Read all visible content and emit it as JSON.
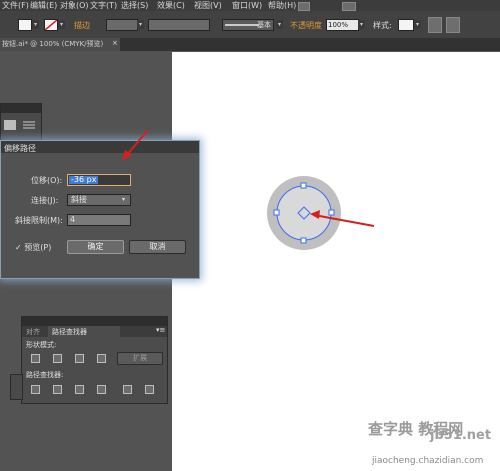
{
  "menu": {
    "file": "文件(F)",
    "edit": "编辑(E)",
    "object": "对象(O)",
    "type": "文字(T)",
    "select": "选择(S)",
    "effect": "效果(C)",
    "view": "视图(V)",
    "window": "窗口(W)",
    "help": "帮助(H)"
  },
  "control": {
    "stroke_label": "描边",
    "brush_label": "基本",
    "opacity_label": "不透明度",
    "opacity_value": "100%",
    "style_label": "样式:"
  },
  "document_tab": {
    "title": "按钮.ai* @ 100% (CMYK/预览)",
    "close": "×"
  },
  "dialog": {
    "title": "偏移路径",
    "offset_label": "位移(O):",
    "offset_value": "-36 px",
    "join_label": "连接(J):",
    "join_value": "斜接",
    "miter_label": "斜接限制(M):",
    "miter_value": "4",
    "preview_label": "✓ 预览(P)",
    "ok_label": "确定",
    "cancel_label": "取消"
  },
  "pathfinder": {
    "tab_align": "对齐",
    "tab_pathfinder": "路径查找器",
    "shape_modes_label": "形状模式:",
    "expand_label": "扩展",
    "pathfinders_label": "路径查找器:"
  },
  "watermark": {
    "line1": "查字典 教程网",
    "line2": "jb51.net",
    "line3": "jiaocheng.chazidian.com"
  },
  "colors": {
    "accent_arrow": "#d42020",
    "selection": "#3a6cf5",
    "outer_circle": "#bfbfbf",
    "inner_circle": "#d9d9d9"
  }
}
